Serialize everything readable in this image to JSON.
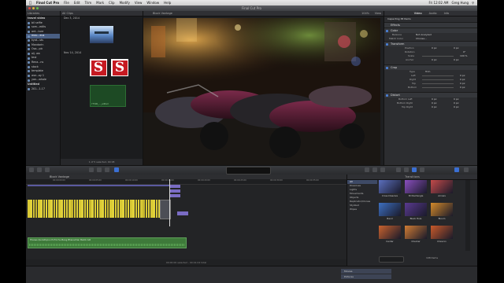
{
  "colors": {
    "accent": "#3b6fd3",
    "clip_yellow": "#e1d23a",
    "clip_purple": "#7a6cc4",
    "clip_green": "#3e7a3a",
    "library_selection": "#4a5f83"
  },
  "menubar": {
    "app": "Final Cut Pro",
    "items": [
      "File",
      "Edit",
      "Trim",
      "Mark",
      "Clip",
      "Modify",
      "View",
      "Window",
      "Help"
    ],
    "status": "Greg Hung",
    "time": "Fri 12:02 AM"
  },
  "window": {
    "title": "Final Cut Pro"
  },
  "library": {
    "header": "Libraries",
    "items": [
      {
        "label": "travel video",
        "top": true
      },
      {
        "label": "bil selfie"
      },
      {
        "label": "som...edits"
      },
      {
        "label": "ant...ture"
      },
      {
        "label": "mou...eus",
        "selected": true
      },
      {
        "label": "kyot...sts"
      },
      {
        "label": "Mandarin"
      },
      {
        "label": "Osa...pic"
      },
      {
        "label": "oij. wa"
      },
      {
        "label": "test"
      },
      {
        "label": "Rena...ns"
      },
      {
        "label": "stock"
      },
      {
        "label": "template"
      },
      {
        "label": "wor...ay 1"
      },
      {
        "label": "yan...whale"
      },
      {
        "label": "Untitled",
        "top": true
      },
      {
        "label": "201...1-17"
      }
    ]
  },
  "browser": {
    "header": "All Clips",
    "date1": "Dec 3, 2014",
    "date2": "Nov 14, 2014",
    "s_letter": "S",
    "green_clip_label": "Y7500_..._edited",
    "footer": "1 of 5 selected, 00:08"
  },
  "viewer": {
    "title": "Block Vantage",
    "zoom": "104%",
    "view": "View"
  },
  "inspector": {
    "tabs": [
      "Video",
      "Audio",
      "Info"
    ],
    "clip_name": "Inspecting 38 Items",
    "sections": {
      "effects": "Effects",
      "color": "Color",
      "balance_label": "Balance",
      "balance_value": "Not Analyzed",
      "match_label": "Match Color",
      "match_value": "Choose...",
      "transform": "Transform",
      "position_label": "Position",
      "rotation_label": "Rotation",
      "scale_label": "Scale",
      "anchor_label": "Anchor",
      "position_x": "0 px",
      "position_y": "0 px",
      "rotation_val": "0°",
      "scale_val": "100 %",
      "crop": "Crop",
      "crop_type_label": "Type",
      "crop_type_value": "Trim",
      "left_label": "Left",
      "right_label": "Right",
      "top_label": "Top",
      "bottom_label": "Bottom",
      "crop_val": "0 px",
      "distort": "Distort",
      "bottom_left": "Bottom Left",
      "bottom_right": "Bottom Right",
      "top_right": "Top Right"
    }
  },
  "timeline": {
    "project": "Block Vantage",
    "timecodes": [
      "00:00:00:00",
      "00:00:05:00",
      "00:00:10:00",
      "00:00:15:00",
      "00:00:20:00",
      "00:00:25:00",
      "00:00:30:00",
      "00:00:35:00"
    ],
    "audio_clip": "Hrenes Qunlutlqcunrh Prol Su Bang Bhanachan Bamb Gill",
    "footer": "00:00:00 selected - 00:41:02 total"
  },
  "transitions": {
    "title": "Transitions",
    "categories": [
      "All",
      "Dissolves",
      "Lights",
      "Movements",
      "Objects",
      "Replicator/Clones",
      "Stylized",
      "Wipes"
    ],
    "items": [
      {
        "label": "Cross Dissolve",
        "color": "#5b6fbe"
      },
      {
        "label": "3D Rectangle",
        "color": "#8a4fbd"
      },
      {
        "label": "Arrows",
        "color": "#c44a4a"
      },
      {
        "label": "Band",
        "color": "#3d6fc0"
      },
      {
        "label": "Black Hole",
        "color": "#5a3a90"
      },
      {
        "label": "Bloom",
        "color": "#d48a2a"
      },
      {
        "label": "Center",
        "color": "#c9622e"
      },
      {
        "label": "Checker",
        "color": "#d07c34"
      },
      {
        "label": "Chevron",
        "color": "#c95a2a"
      }
    ],
    "count": "108 items"
  },
  "dock": {
    "items": [
      "Movies",
      "Pictures"
    ]
  }
}
